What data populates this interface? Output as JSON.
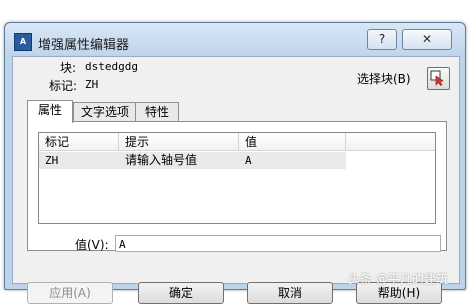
{
  "window": {
    "title": "增强属性编辑器",
    "help_label": "?",
    "close_label": "✕"
  },
  "header": {
    "block_label": "块:",
    "block_value": "dstedgdg",
    "tag_label": "标记:",
    "tag_value": "ZH",
    "select_block_label": "选择块(B)"
  },
  "tabs": [
    {
      "label": "属性",
      "active": true
    },
    {
      "label": "文字选项",
      "active": false
    },
    {
      "label": "特性",
      "active": false
    }
  ],
  "table": {
    "columns": [
      "标记",
      "提示",
      "值"
    ],
    "rows": [
      {
        "tag": "ZH",
        "prompt": "请输入轴号值",
        "value": "A"
      }
    ]
  },
  "value_field": {
    "label": "值(V):",
    "value": "A"
  },
  "buttons": {
    "apply": "应用(A)",
    "ok": "确定",
    "cancel": "取消",
    "help": "帮助(H)"
  },
  "watermark": "头条 @平凡的建筑"
}
